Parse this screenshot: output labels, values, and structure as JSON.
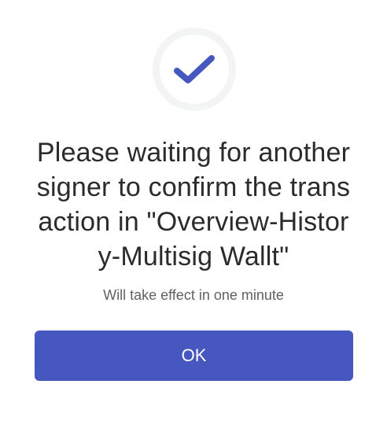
{
  "dialog": {
    "status_icon": "check-icon",
    "title": "Please waiting for another signer to confirm the transaction in \"Overview-History-Multisig Wallt\"",
    "subtitle": "Will take effect in one minute",
    "ok_label": "OK"
  },
  "colors": {
    "accent": "#4658c0",
    "title_text": "#2b2b2b",
    "subtitle_text": "#616161",
    "icon_ring": "#f3f4f6"
  }
}
